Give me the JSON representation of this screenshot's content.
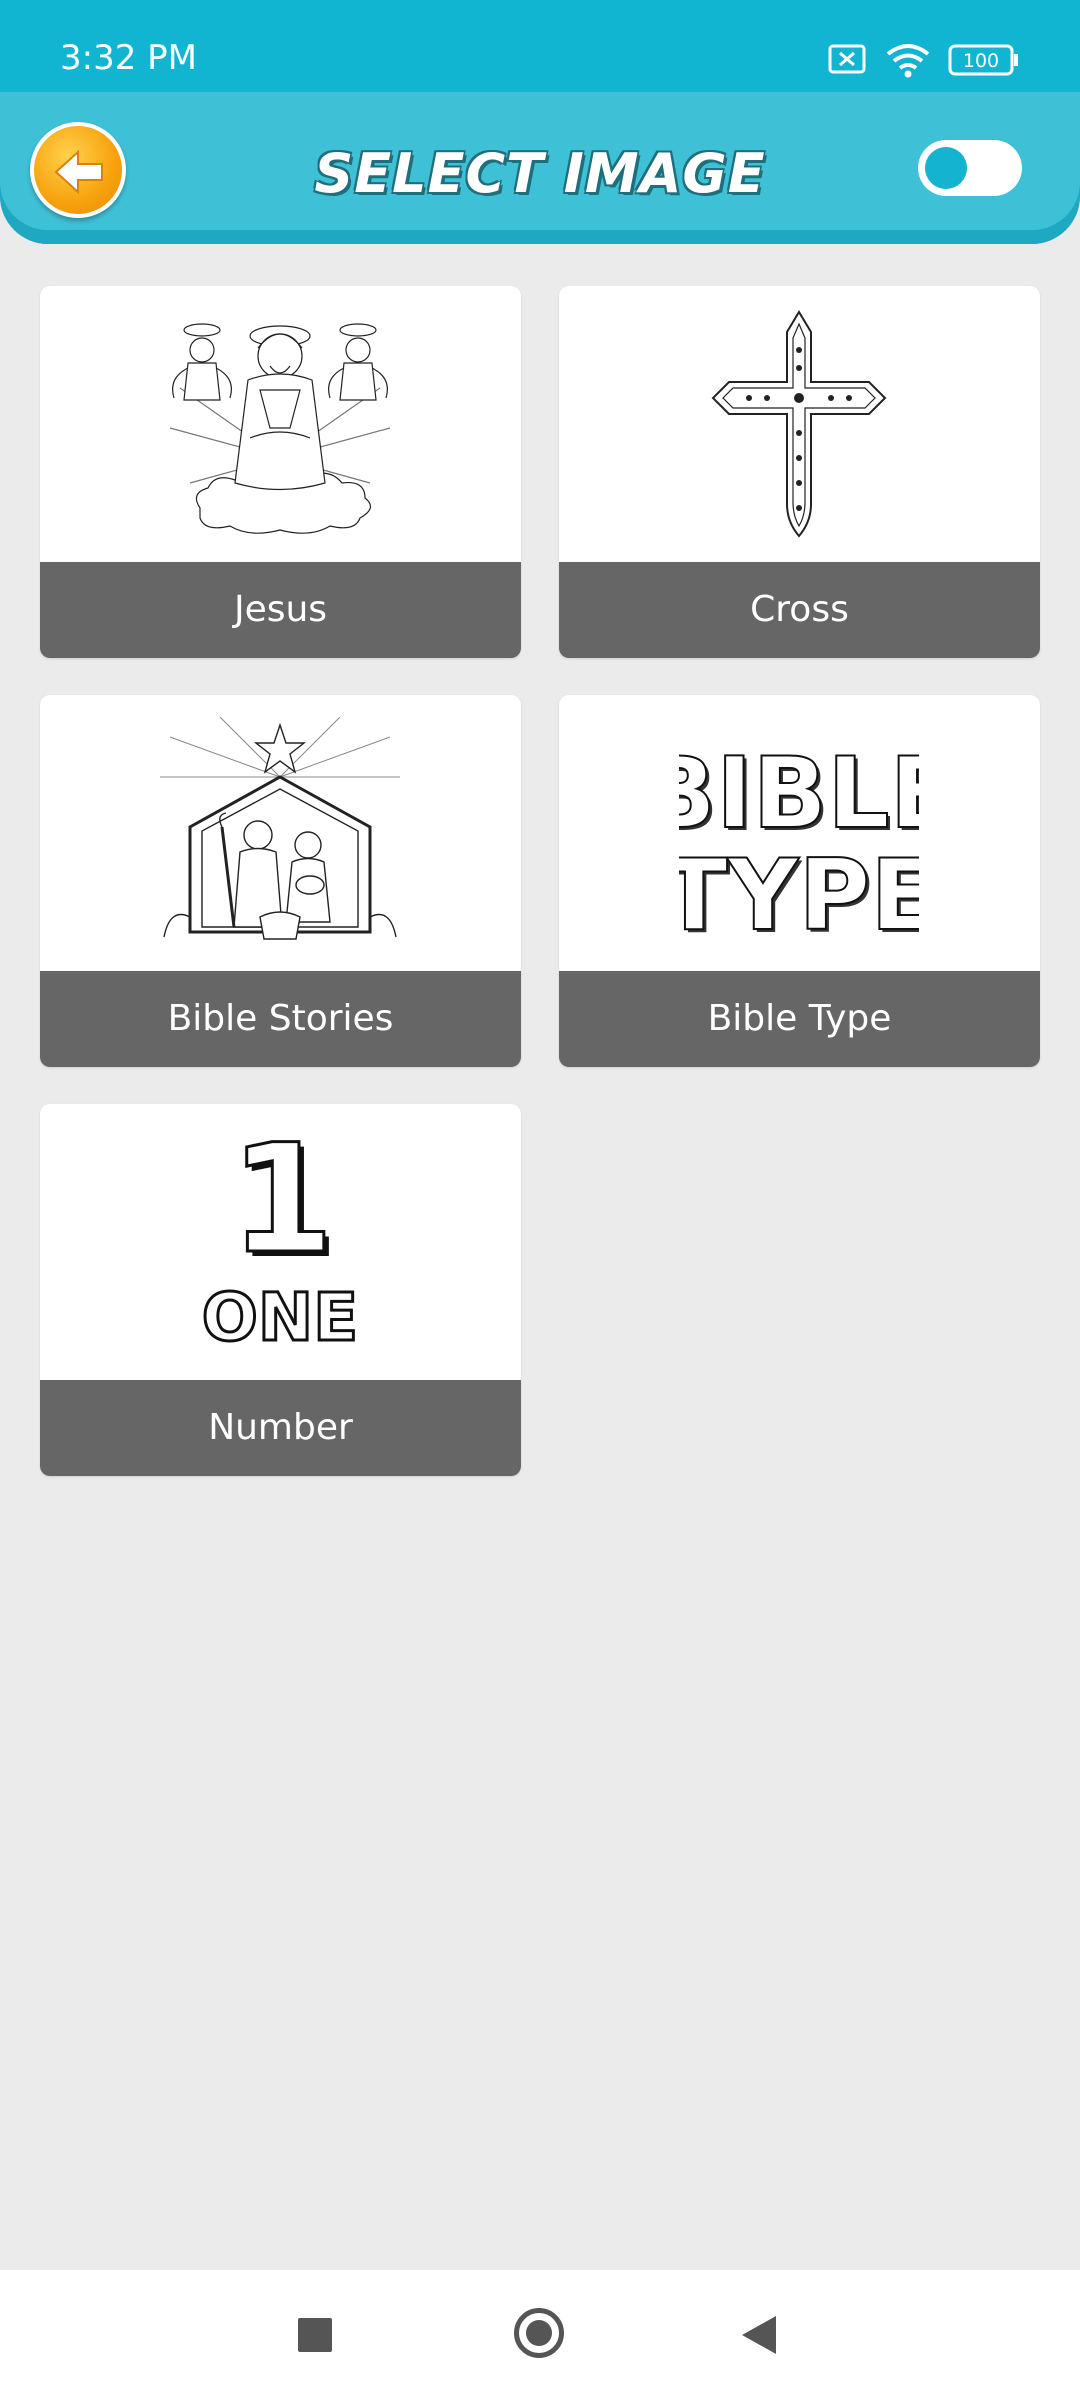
{
  "status_bar": {
    "time": "3:32 PM",
    "battery": "100",
    "icons": [
      "sim-off-icon",
      "wifi-icon",
      "battery-icon"
    ]
  },
  "header": {
    "title": "SELECT IMAGE",
    "back_icon": "back-arrow-icon",
    "toggle_state": "off"
  },
  "categories": [
    {
      "label": "Jesus",
      "icon": "jesus-drawing"
    },
    {
      "label": "Cross",
      "icon": "cross-drawing"
    },
    {
      "label": "Bible Stories",
      "icon": "nativity-drawing"
    },
    {
      "label": "Bible Type",
      "icon": "bible-type-drawing",
      "art_text": [
        "BIBLE",
        "TYPE"
      ]
    },
    {
      "label": "Number",
      "icon": "number-one-drawing",
      "art_text": [
        "1",
        "ONE"
      ]
    }
  ],
  "nav_bar": {
    "icons": [
      "recent-apps-icon",
      "home-icon",
      "back-icon"
    ]
  },
  "colors": {
    "status_bar": "#11b4d1",
    "header": "#3ec0d6",
    "background": "#ecebec",
    "card_label": "#666666",
    "back_button": "#f7a10c"
  }
}
